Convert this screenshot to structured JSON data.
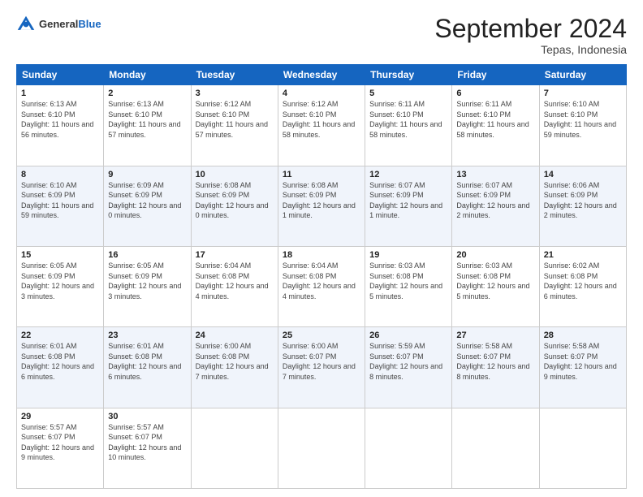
{
  "header": {
    "logo_general": "General",
    "logo_blue": "Blue",
    "month_title": "September 2024",
    "location": "Tepas, Indonesia"
  },
  "days_of_week": [
    "Sunday",
    "Monday",
    "Tuesday",
    "Wednesday",
    "Thursday",
    "Friday",
    "Saturday"
  ],
  "weeks": [
    [
      {
        "day": "1",
        "sunrise": "6:13 AM",
        "sunset": "6:10 PM",
        "daylight": "11 hours and 56 minutes."
      },
      {
        "day": "2",
        "sunrise": "6:13 AM",
        "sunset": "6:10 PM",
        "daylight": "11 hours and 57 minutes."
      },
      {
        "day": "3",
        "sunrise": "6:12 AM",
        "sunset": "6:10 PM",
        "daylight": "11 hours and 57 minutes."
      },
      {
        "day": "4",
        "sunrise": "6:12 AM",
        "sunset": "6:10 PM",
        "daylight": "11 hours and 58 minutes."
      },
      {
        "day": "5",
        "sunrise": "6:11 AM",
        "sunset": "6:10 PM",
        "daylight": "11 hours and 58 minutes."
      },
      {
        "day": "6",
        "sunrise": "6:11 AM",
        "sunset": "6:10 PM",
        "daylight": "11 hours and 58 minutes."
      },
      {
        "day": "7",
        "sunrise": "6:10 AM",
        "sunset": "6:10 PM",
        "daylight": "11 hours and 59 minutes."
      }
    ],
    [
      {
        "day": "8",
        "sunrise": "6:10 AM",
        "sunset": "6:09 PM",
        "daylight": "11 hours and 59 minutes."
      },
      {
        "day": "9",
        "sunrise": "6:09 AM",
        "sunset": "6:09 PM",
        "daylight": "12 hours and 0 minutes."
      },
      {
        "day": "10",
        "sunrise": "6:08 AM",
        "sunset": "6:09 PM",
        "daylight": "12 hours and 0 minutes."
      },
      {
        "day": "11",
        "sunrise": "6:08 AM",
        "sunset": "6:09 PM",
        "daylight": "12 hours and 1 minute."
      },
      {
        "day": "12",
        "sunrise": "6:07 AM",
        "sunset": "6:09 PM",
        "daylight": "12 hours and 1 minute."
      },
      {
        "day": "13",
        "sunrise": "6:07 AM",
        "sunset": "6:09 PM",
        "daylight": "12 hours and 2 minutes."
      },
      {
        "day": "14",
        "sunrise": "6:06 AM",
        "sunset": "6:09 PM",
        "daylight": "12 hours and 2 minutes."
      }
    ],
    [
      {
        "day": "15",
        "sunrise": "6:05 AM",
        "sunset": "6:09 PM",
        "daylight": "12 hours and 3 minutes."
      },
      {
        "day": "16",
        "sunrise": "6:05 AM",
        "sunset": "6:09 PM",
        "daylight": "12 hours and 3 minutes."
      },
      {
        "day": "17",
        "sunrise": "6:04 AM",
        "sunset": "6:08 PM",
        "daylight": "12 hours and 4 minutes."
      },
      {
        "day": "18",
        "sunrise": "6:04 AM",
        "sunset": "6:08 PM",
        "daylight": "12 hours and 4 minutes."
      },
      {
        "day": "19",
        "sunrise": "6:03 AM",
        "sunset": "6:08 PM",
        "daylight": "12 hours and 5 minutes."
      },
      {
        "day": "20",
        "sunrise": "6:03 AM",
        "sunset": "6:08 PM",
        "daylight": "12 hours and 5 minutes."
      },
      {
        "day": "21",
        "sunrise": "6:02 AM",
        "sunset": "6:08 PM",
        "daylight": "12 hours and 6 minutes."
      }
    ],
    [
      {
        "day": "22",
        "sunrise": "6:01 AM",
        "sunset": "6:08 PM",
        "daylight": "12 hours and 6 minutes."
      },
      {
        "day": "23",
        "sunrise": "6:01 AM",
        "sunset": "6:08 PM",
        "daylight": "12 hours and 6 minutes."
      },
      {
        "day": "24",
        "sunrise": "6:00 AM",
        "sunset": "6:08 PM",
        "daylight": "12 hours and 7 minutes."
      },
      {
        "day": "25",
        "sunrise": "6:00 AM",
        "sunset": "6:07 PM",
        "daylight": "12 hours and 7 minutes."
      },
      {
        "day": "26",
        "sunrise": "5:59 AM",
        "sunset": "6:07 PM",
        "daylight": "12 hours and 8 minutes."
      },
      {
        "day": "27",
        "sunrise": "5:58 AM",
        "sunset": "6:07 PM",
        "daylight": "12 hours and 8 minutes."
      },
      {
        "day": "28",
        "sunrise": "5:58 AM",
        "sunset": "6:07 PM",
        "daylight": "12 hours and 9 minutes."
      }
    ],
    [
      {
        "day": "29",
        "sunrise": "5:57 AM",
        "sunset": "6:07 PM",
        "daylight": "12 hours and 9 minutes."
      },
      {
        "day": "30",
        "sunrise": "5:57 AM",
        "sunset": "6:07 PM",
        "daylight": "12 hours and 10 minutes."
      },
      null,
      null,
      null,
      null,
      null
    ]
  ]
}
